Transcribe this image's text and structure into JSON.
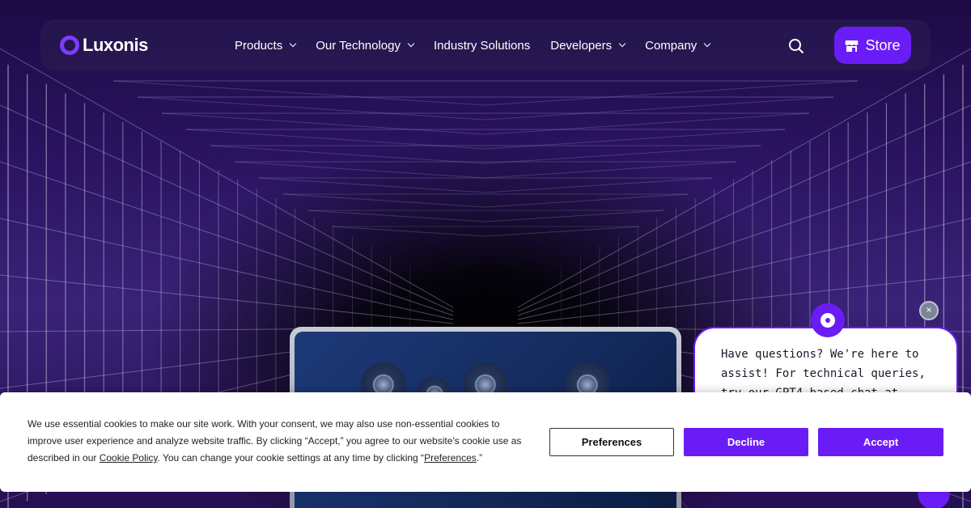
{
  "colors": {
    "accent": "#6a1cf6",
    "nav_bg": "#281850",
    "text_light": "#ffffff"
  },
  "brand": {
    "logo_icon": "luxonis-ring-icon",
    "name": "Luxonis"
  },
  "nav": {
    "items": [
      {
        "label": "Products",
        "has_dropdown": true
      },
      {
        "label": "Our Technology",
        "has_dropdown": true
      },
      {
        "label": "Industry Solutions",
        "has_dropdown": false
      },
      {
        "label": "Developers",
        "has_dropdown": true
      },
      {
        "label": "Company",
        "has_dropdown": true
      }
    ],
    "search_icon": "search-icon",
    "store_icon": "store-icon",
    "store_label": "Store"
  },
  "chat": {
    "avatar_icon": "luxonis-ring-icon",
    "close_icon": "close-icon",
    "close_glyph": "×",
    "message": "Have questions? We're here to assist! For technical queries, try our GPT4-based chat at"
  },
  "cookie": {
    "text_before_link": "We use essential cookies to make our site work. With your consent, we may also use non-essential cookies to improve user experience and analyze website traffic. By clicking “Accept,” you agree to our website's cookie use as described in our ",
    "policy_link": "Cookie Policy",
    "text_middle": ". You can change your cookie settings at any time by clicking “",
    "preferences_link": "Preferences",
    "text_end": ".”",
    "buttons": {
      "preferences": "Preferences",
      "decline": "Decline",
      "accept": "Accept"
    }
  }
}
